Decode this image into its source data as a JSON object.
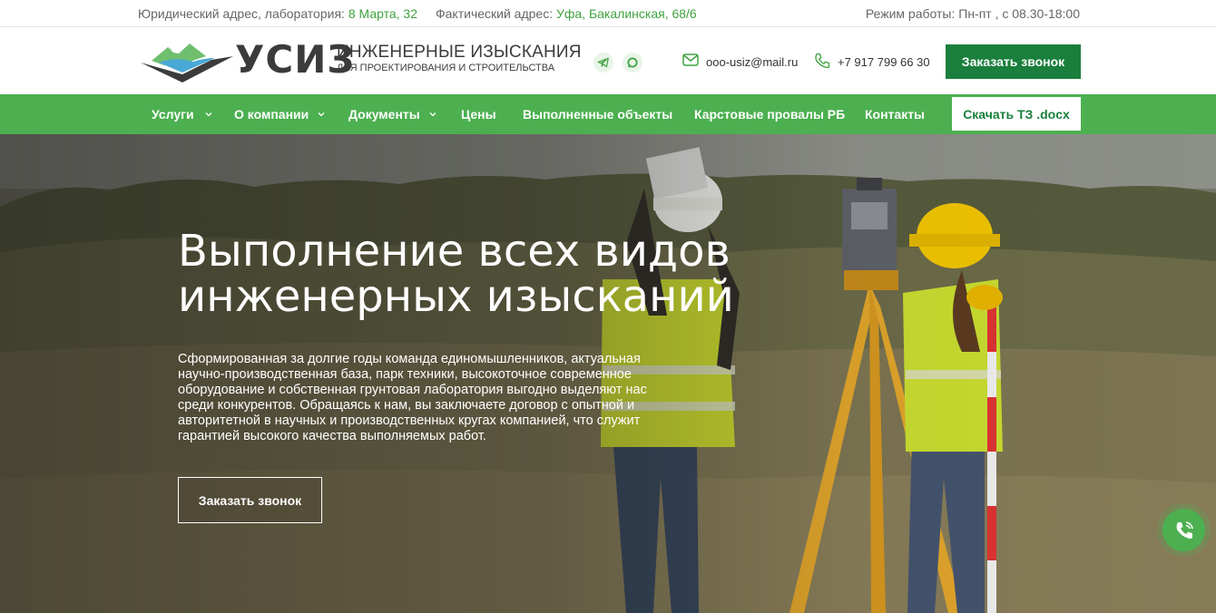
{
  "topbar": {
    "legal_label": "Юридический адрес, лаборатория:",
    "legal_value": "8 Марта, 32",
    "fact_label": "Фактический адрес:",
    "fact_value": "Уфа, Бакалинская, 68/6",
    "hours": "Режим работы: Пн-пт , с 08.30-18:00"
  },
  "header": {
    "logo_text": "УСИЗ",
    "tagline_1": "ИНЖЕНЕРНЫЕ ИЗЫСКАНИЯ",
    "tagline_2": "ДЛЯ ПРОЕКТИРОВАНИЯ И СТРОИТЕЛЬСТВА",
    "email": "ooo-usiz@mail.ru",
    "phone": "+7 917 799 66 30",
    "call_button": "Заказать звонок"
  },
  "nav": {
    "items": [
      {
        "label": "Услуги",
        "dropdown": true
      },
      {
        "label": "О компании",
        "dropdown": true
      },
      {
        "label": "Документы",
        "dropdown": true
      },
      {
        "label": "Цены",
        "dropdown": false
      },
      {
        "label": "Выполненные объекты",
        "dropdown": false
      },
      {
        "label": "Карстовые провалы РБ",
        "dropdown": false
      },
      {
        "label": "Контакты",
        "dropdown": false
      }
    ],
    "download_button": "Скачать ТЗ .docx"
  },
  "hero": {
    "title_line1": "Выполнение всех видов",
    "title_line2": "инженерных изысканий",
    "text_lines": [
      "Сформированная за долгие годы команда единомышленников, актуальная",
      "научно-производственная база, парк техники, высокоточное современное",
      "оборудование и собственная грунтовая лаборатория выгодно выделяют нас",
      "среди конкурентов. Обращаясь к нам, вы заключаете договор с опытной и",
      "авторитетной в научных и производственных кругах компанией, что служит",
      "гарантией высокого качества выполняемых работ."
    ],
    "button": "Заказать звонок"
  },
  "colors": {
    "brand_green": "#4cb050",
    "dark_green": "#1a7f3c",
    "accent_text": "#3fa33f"
  },
  "icons": {
    "telegram": "telegram-icon",
    "whatsapp": "whatsapp-icon",
    "mail": "mail-icon",
    "phone": "phone-icon",
    "fab": "phone-call-icon"
  }
}
